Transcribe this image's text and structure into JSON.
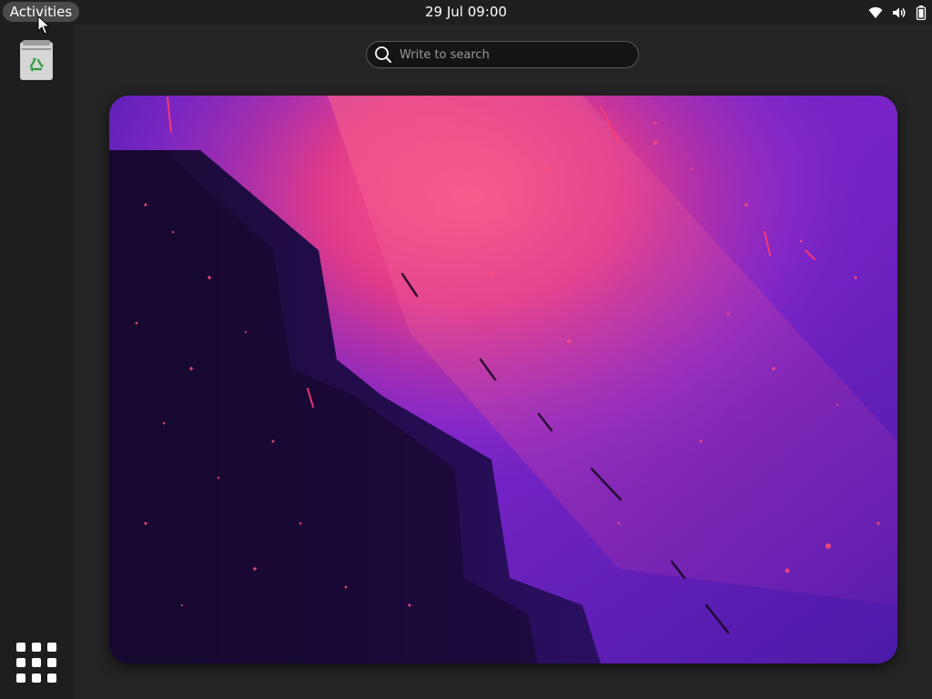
{
  "topbar": {
    "activities_label": "Activities",
    "clock": "29 Jul 09:00",
    "status_icons": [
      "wifi-icon",
      "volume-icon",
      "battery-icon"
    ]
  },
  "search": {
    "placeholder": "Write to search",
    "value": ""
  },
  "dash": {
    "items": [
      {
        "name": "trash",
        "icon": "trash-icon"
      }
    ],
    "show_apps_icon": "app-grid-icon"
  },
  "workspace": {
    "wallpaper": "wallpaper-image"
  },
  "colors": {
    "panel": "#1f1f1f",
    "background": "#242424",
    "dash": "#1e1e1e",
    "activities_pill": "#4a4a4a",
    "wallpaper_dark": "#1c0a3c",
    "wallpaper_purple": "#6a1fc8",
    "wallpaper_pink": "#f0447a"
  }
}
